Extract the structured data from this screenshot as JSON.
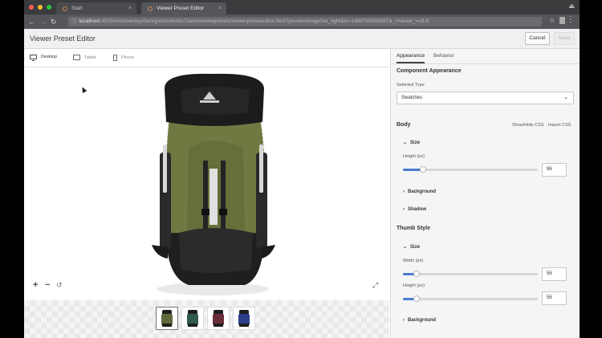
{
  "browser": {
    "tabs": [
      {
        "label": "Start"
      },
      {
        "label": "Viewer Preset Editor"
      }
    ],
    "url_host": "localhost",
    "url_rest": ":4502/mnt/overlay/dam/gui/content/s7dam/viewerpresets/viewerpreseteditor.html?preset=imageSet_light&ts=1489790000887&_charset_=utf-8"
  },
  "app": {
    "title": "Viewer Preset Editor",
    "cancel_label": "Cancel",
    "save_label": "Save"
  },
  "devices": [
    {
      "label": "Desktop",
      "icon": "monitor-icon",
      "active": true
    },
    {
      "label": "Tablet",
      "icon": "tablet-icon",
      "active": false
    },
    {
      "label": "Phone",
      "icon": "phone-icon",
      "active": false
    }
  ],
  "swatches": [
    {
      "color": "#5e6a3c",
      "selected": true
    },
    {
      "color": "#2f5a4c",
      "selected": false
    },
    {
      "color": "#6a2d3a",
      "selected": false
    },
    {
      "color": "#2c3e8a",
      "selected": false
    }
  ],
  "panel": {
    "tabs": [
      {
        "label": "Appearance",
        "active": true
      },
      {
        "label": "Behavior",
        "active": false
      }
    ],
    "section_title": "Component Appearance",
    "selected_type_label": "Selected Type",
    "selected_type_value": "Swatches",
    "body": {
      "title": "Body",
      "show_hide_css": "Show/Hide CSS",
      "import_css": "Import CSS",
      "size_label": "Size",
      "height_label": "Height (px)",
      "height_value": "96",
      "height_fraction": 0.15,
      "background_label": "Background",
      "shadow_label": "Shadow"
    },
    "thumb": {
      "title": "Thumb Style",
      "size_label": "Size",
      "width_label": "Width (px)",
      "width_value": "56",
      "width_fraction": 0.1,
      "height_label": "Height (px)",
      "height_value": "56",
      "height_fraction": 0.1,
      "background_label": "Background"
    }
  },
  "colors": {
    "accent": "#4a7bd0",
    "backpack_body": "#6f7a43",
    "backpack_dark": "#1e1e1e"
  }
}
